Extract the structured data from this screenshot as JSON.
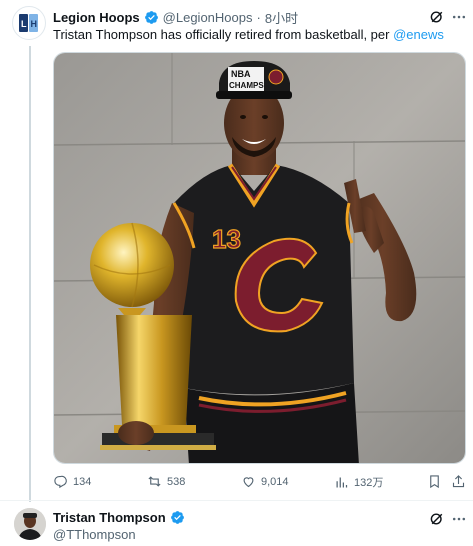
{
  "tweet": {
    "author_name": "Legion Hoops",
    "author_handle": "@LegionHoops",
    "separator": "·",
    "time": "8小时",
    "text_prefix": "Tristan Thompson has officially retired from basketball, per ",
    "text_mention": "@enews",
    "media": {
      "cap_text_line1": "NBA",
      "cap_text_line2": "CHAMPS",
      "jersey_number": "13"
    },
    "actions": {
      "replies": "134",
      "reposts": "538",
      "likes": "9,014",
      "views": "132万"
    }
  },
  "reply_preview": {
    "author_name": "Tristan Thompson",
    "author_handle": "@TThompson"
  },
  "icons": {
    "verified": "verified-badge-icon",
    "grok": "grok-icon",
    "more": "more-options-icon",
    "reply": "reply-icon",
    "repost": "repost-icon",
    "like": "like-icon",
    "views": "views-icon",
    "bookmark": "bookmark-icon",
    "share": "share-icon"
  },
  "colors": {
    "accent": "#1d9bf0",
    "text": "#0f1419",
    "secondary": "#536471"
  }
}
